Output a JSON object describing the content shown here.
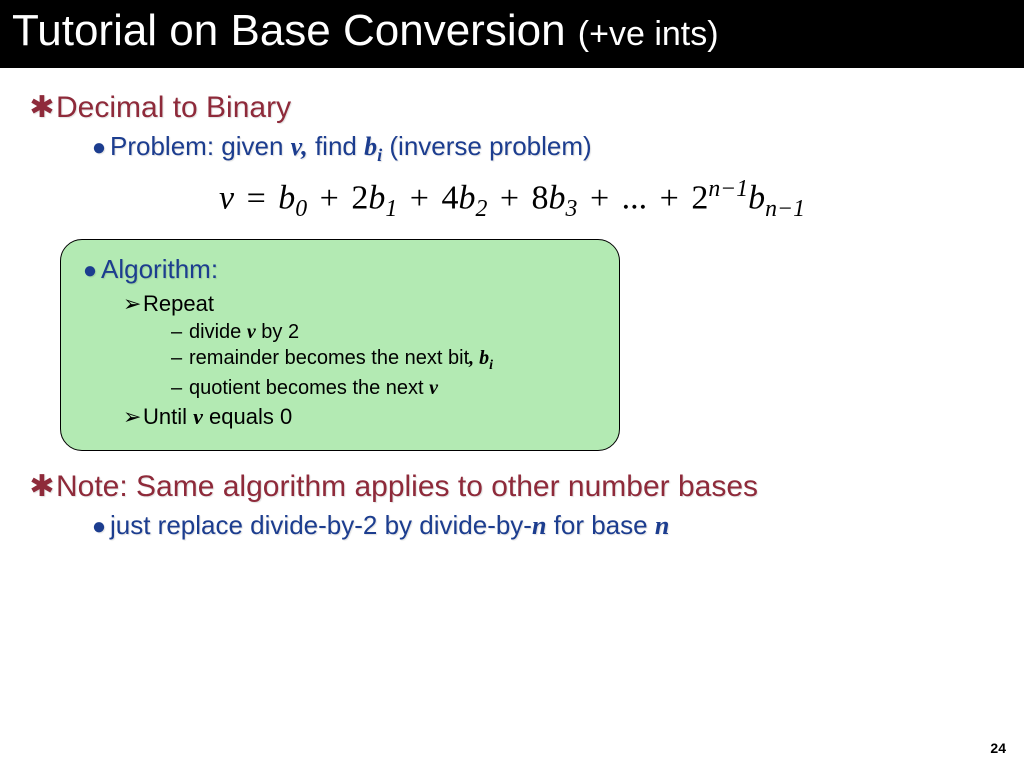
{
  "title": {
    "main": "Tutorial on Base Conversion ",
    "sub": "(+ve ints)"
  },
  "heading1": "Decimal to Binary",
  "problem": {
    "prefix": "Problem:  given ",
    "var_v": "v,",
    "mid": " find ",
    "var_b": "b",
    "var_b_sub": "i",
    "suffix": " (inverse problem)"
  },
  "equation": {
    "v": "v",
    "eq": "=",
    "b0": "b",
    "b0s": "0",
    "p": "+",
    "c1": "2",
    "b1": "b",
    "b1s": "1",
    "c2": "4",
    "b2": "b",
    "b2s": "2",
    "c3": "8",
    "b3": "b",
    "b3s": "3",
    "dots": "...",
    "cn": "2",
    "cns": "n−1",
    "bn": "b",
    "bns": "n−1"
  },
  "algo": {
    "label": "Algorithm:",
    "repeat": "Repeat",
    "step1_pre": "divide ",
    "step1_v": "v",
    "step1_post": " by 2",
    "step2_pre": "remainder becomes the next bit",
    "step2_comma": ", ",
    "step2_b": "b",
    "step2_bsub": "i",
    "step3_pre": "quotient becomes the next ",
    "step3_v": "v",
    "until_pre": "Until ",
    "until_v": "v",
    "until_post": " equals 0"
  },
  "note": "Note:  Same algorithm applies to other number bases",
  "note_sub": {
    "pre": "just replace divide-by-2 by divide-by-",
    "n1": "n",
    "mid": " for base ",
    "n2": "n"
  },
  "page": "24"
}
